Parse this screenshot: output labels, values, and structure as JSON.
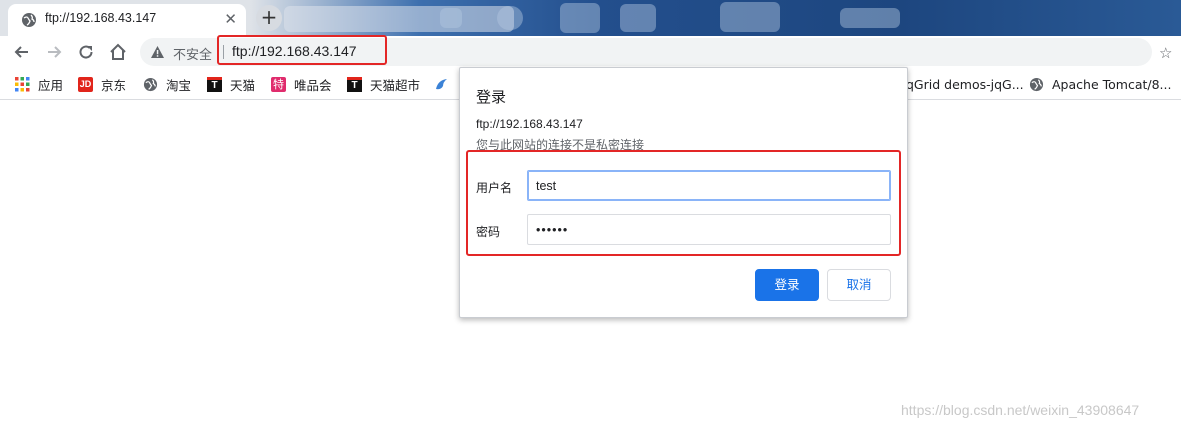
{
  "tab": {
    "title": "ftp://192.168.43.147",
    "close_icon": "close-icon"
  },
  "new_tab": {
    "label": "+"
  },
  "toolbar": {
    "security_text": "不安全",
    "url": "ftp://192.168.43.147",
    "star_glyph": "☆"
  },
  "bookmarks": [
    {
      "label": "应用",
      "icon": "apps-grid-icon"
    },
    {
      "label": "京东",
      "icon": "jd-icon",
      "glyph": "JD"
    },
    {
      "label": "淘宝",
      "icon": "globe-icon"
    },
    {
      "label": "天猫",
      "icon": "tmall-icon",
      "glyph": "T"
    },
    {
      "label": "唯品会",
      "icon": "vip-icon",
      "glyph": "特"
    },
    {
      "label": "天猫超市",
      "icon": "tmall-icon",
      "glyph": "T"
    },
    {
      "label": "jqGrid demos-jqG...",
      "visible_text": "qGrid demos-jqG...",
      "icon": "globe-icon"
    },
    {
      "label": "Apache Tomcat/8...",
      "icon": "globe-icon"
    }
  ],
  "dialog": {
    "title": "登录",
    "site": "ftp://192.168.43.147",
    "note": "您与此网站的连接不是私密连接",
    "username_label": "用户名",
    "username_value": "test",
    "password_label": "密码",
    "password_value": "••••••",
    "login_button": "登录",
    "cancel_button": "取消"
  },
  "watermark": "https://blog.csdn.net/weixin_43908647",
  "colors": {
    "accent": "#1a73e8",
    "highlight_box": "#e32626",
    "focus_ring": "#8ab4f8"
  }
}
